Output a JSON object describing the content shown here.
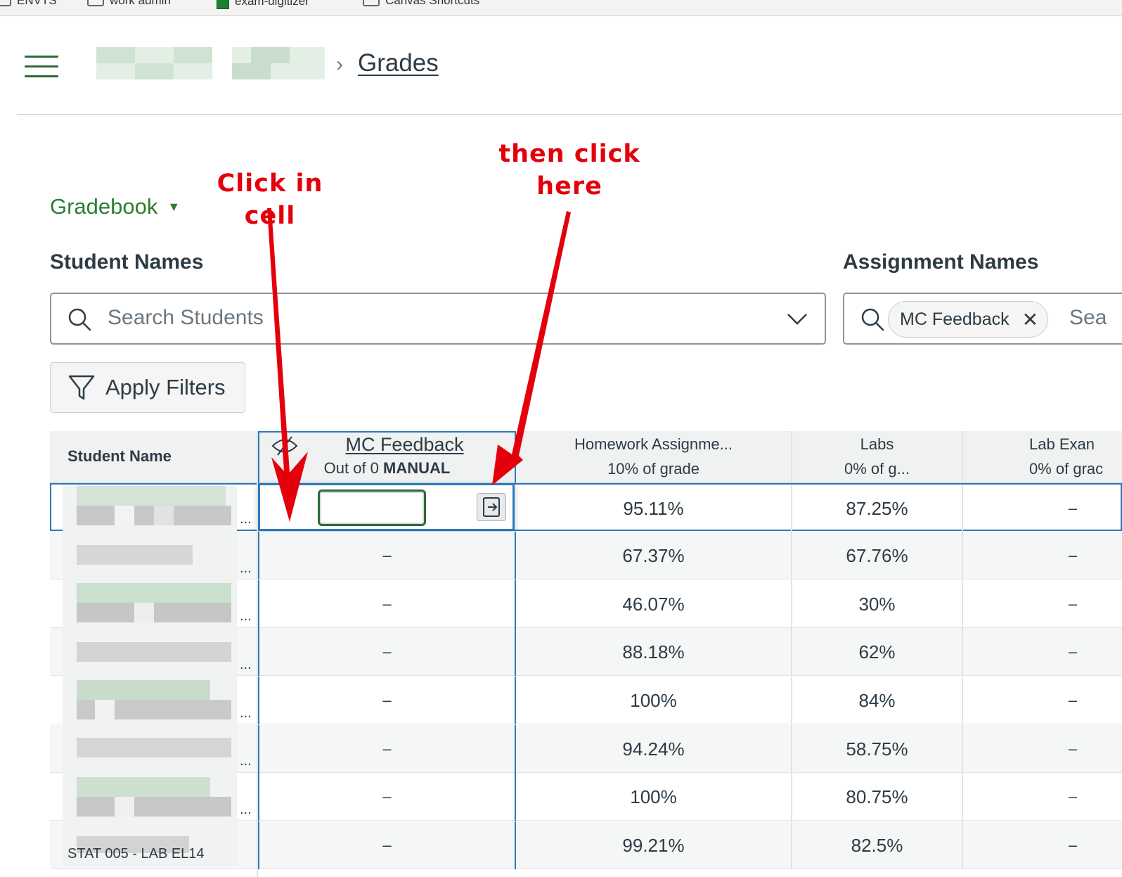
{
  "bookmarks": [
    "ENVTS",
    "work admin",
    "exam-digitizer",
    "Canvas Shortcuts"
  ],
  "breadcrumb": {
    "current": "Grades"
  },
  "annotations": {
    "click_in_cell": "Click in cell",
    "then_click_here_1": "then click",
    "then_click_here_2": "here"
  },
  "gradebook_menu": {
    "label": "Gradebook"
  },
  "student_filter": {
    "label": "Student Names",
    "placeholder": "Search Students"
  },
  "assignment_filter": {
    "label": "Assignment Names",
    "chip": "MC Feedback",
    "placeholder_partial": "Sea"
  },
  "apply_filters": {
    "label": "Apply Filters"
  },
  "columns": [
    {
      "title": "Student Name"
    },
    {
      "title": "MC Feedback",
      "sub_prefix": "Out of 0 ",
      "sub_strong": "MANUAL"
    },
    {
      "title": "Homework Assignme...",
      "sub": "10% of grade"
    },
    {
      "title": "Labs",
      "sub": "0% of g..."
    },
    {
      "title": "Lab Exan",
      "sub": "0% of grac"
    }
  ],
  "rows": [
    {
      "mc": "",
      "homework": "95.11%",
      "labs": "87.25%",
      "lab_exam": "–"
    },
    {
      "mc": "–",
      "homework": "67.37%",
      "labs": "67.76%",
      "lab_exam": "–"
    },
    {
      "mc": "–",
      "homework": "46.07%",
      "labs": "30%",
      "lab_exam": "–"
    },
    {
      "mc": "–",
      "homework": "88.18%",
      "labs": "62%",
      "lab_exam": "–"
    },
    {
      "mc": "–",
      "homework": "100%",
      "labs": "84%",
      "lab_exam": "–"
    },
    {
      "mc": "–",
      "homework": "94.24%",
      "labs": "58.75%",
      "lab_exam": "–"
    },
    {
      "mc": "–",
      "homework": "100%",
      "labs": "80.75%",
      "lab_exam": "–"
    },
    {
      "mc": "–",
      "homework": "99.21%",
      "labs": "82.5%",
      "lab_exam": "–"
    }
  ],
  "partial_student_text": "STAT 005 - LAB EL14",
  "row_ellipsis": "...",
  "colors": {
    "accent_green": "#2e7d32",
    "annotation_red": "#e3000b",
    "selection_blue": "#2b7abc"
  }
}
